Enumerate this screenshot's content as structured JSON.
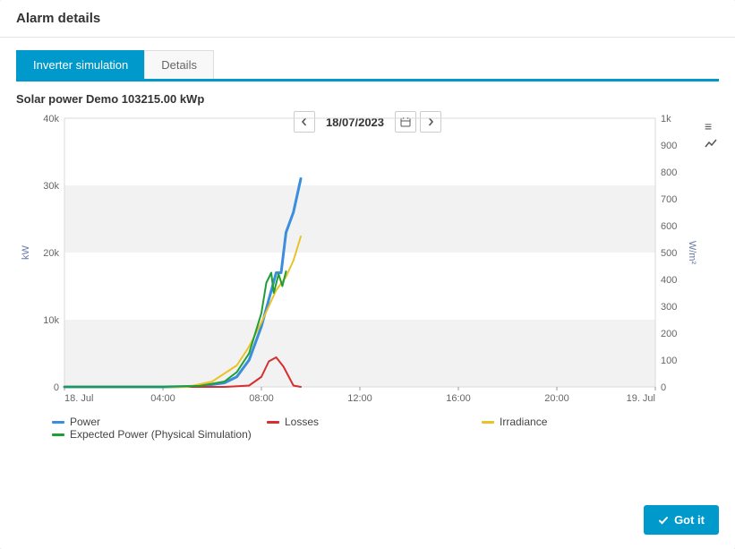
{
  "header": {
    "title": "Alarm details"
  },
  "tabs": [
    {
      "label": "Inverter simulation",
      "active": true
    },
    {
      "label": "Details",
      "active": false
    }
  ],
  "chart_header": {
    "title": "Solar power Demo 103215.00 kWp",
    "date": "18/07/2023"
  },
  "chart_data": {
    "type": "line",
    "x_start": "18. Jul",
    "x_end": "19. Jul",
    "x_ticks_hours": [
      0,
      4,
      8,
      12,
      16,
      20,
      24
    ],
    "x_tick_labels": [
      "18. Jul",
      "04:00",
      "08:00",
      "12:00",
      "16:00",
      "20:00",
      "19. Jul"
    ],
    "y_left": {
      "label": "kW",
      "min": 0,
      "max": 40000,
      "ticks": [
        0,
        "10k",
        "20k",
        "30k",
        "40k"
      ]
    },
    "y_right": {
      "label": "W/m²",
      "min": 0,
      "max": 1000,
      "ticks": [
        0,
        100,
        200,
        300,
        400,
        500,
        600,
        700,
        800,
        900,
        "1k"
      ]
    },
    "series": [
      {
        "name": "Power",
        "color": "#3b8ede",
        "axis": "left",
        "points": [
          [
            0,
            0
          ],
          [
            4,
            0
          ],
          [
            5.5,
            100
          ],
          [
            6.5,
            600
          ],
          [
            7.0,
            1500
          ],
          [
            7.5,
            4000
          ],
          [
            8.0,
            9000
          ],
          [
            8.3,
            13000
          ],
          [
            8.6,
            17000
          ],
          [
            8.8,
            17000
          ],
          [
            9.0,
            23000
          ],
          [
            9.3,
            26000
          ],
          [
            9.6,
            31000
          ]
        ]
      },
      {
        "name": "Losses",
        "color": "#d62f2f",
        "axis": "left",
        "points": [
          [
            0,
            0
          ],
          [
            6.5,
            0
          ],
          [
            7.5,
            200
          ],
          [
            8.0,
            1500
          ],
          [
            8.3,
            3800
          ],
          [
            8.6,
            4400
          ],
          [
            8.9,
            3000
          ],
          [
            9.3,
            200
          ],
          [
            9.6,
            0
          ]
        ]
      },
      {
        "name": "Irradiance",
        "color": "#e9c229",
        "axis": "right",
        "points": [
          [
            0,
            0
          ],
          [
            5.0,
            0
          ],
          [
            6.0,
            20
          ],
          [
            7.0,
            80
          ],
          [
            7.5,
            150
          ],
          [
            8.0,
            240
          ],
          [
            8.3,
            300
          ],
          [
            8.6,
            360
          ],
          [
            9.0,
            410
          ],
          [
            9.3,
            470
          ],
          [
            9.6,
            560
          ]
        ]
      },
      {
        "name": "Expected Power (Physical Simulation)",
        "color": "#1f9e34",
        "axis": "left",
        "points": [
          [
            0,
            0
          ],
          [
            4,
            0
          ],
          [
            5.5,
            150
          ],
          [
            6.5,
            800
          ],
          [
            7.0,
            2200
          ],
          [
            7.5,
            5000
          ],
          [
            8.0,
            11000
          ],
          [
            8.2,
            15500
          ],
          [
            8.4,
            17000
          ],
          [
            8.5,
            14000
          ],
          [
            8.7,
            16800
          ],
          [
            8.85,
            15000
          ],
          [
            9.0,
            17200
          ]
        ]
      }
    ]
  },
  "footer": {
    "confirm": "Got it"
  },
  "colors": {
    "primary": "#0099cc"
  }
}
